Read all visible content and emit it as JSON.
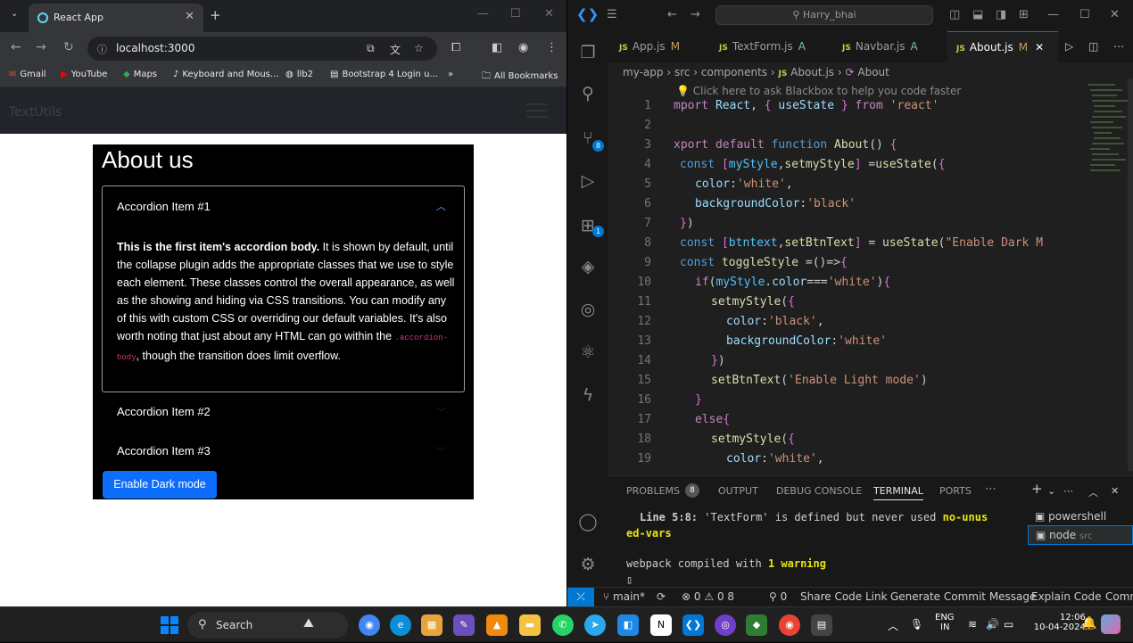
{
  "browser": {
    "tab_title": "React App",
    "url": "localhost:3000",
    "bookmarks": [
      "Gmail",
      "YouTube",
      "Maps",
      "Keyboard and Mous...",
      "llb2",
      "Bootstrap 4 Login u...",
      "All Bookmarks"
    ],
    "page": {
      "brand": "TextUtils",
      "heading": "About us",
      "accordion": [
        {
          "label": "Accordion Item #1",
          "expanded": true,
          "body_strong": "This is the first item's accordion body.",
          "body_text": " It is shown by default, until the collapse plugin adds the appropriate classes that we use to style each element. These classes control the overall appearance, as well as the showing and hiding via CSS transitions. You can modify any of this with custom CSS or overriding our default variables. It's also worth noting that just about any HTML can go within the ",
          "body_code": ".accordion-body",
          "body_tail": ", though the transition does limit overflow."
        },
        {
          "label": "Accordion Item #2",
          "expanded": false
        },
        {
          "label": "Accordion Item #3",
          "expanded": false
        }
      ],
      "button": "Enable Dark mode",
      "accent": "#0d6efd"
    }
  },
  "vscode": {
    "command_center": "Harry_bhai",
    "tabs": [
      {
        "name": "App.js",
        "status": "M"
      },
      {
        "name": "TextForm.js",
        "status": "A"
      },
      {
        "name": "Navbar.js",
        "status": "A"
      },
      {
        "name": "About.js",
        "status": "M"
      }
    ],
    "breadcrumb": [
      "my-app",
      "src",
      "components",
      "About.js",
      "About"
    ],
    "hint": "Click here to ask Blackbox to help you code faster",
    "code_lines": [
      {
        "n": "1",
        "t": "mport React, { useState } from 'react'"
      },
      {
        "n": "2",
        "t": ""
      },
      {
        "n": "3",
        "t": "xport default function About() {"
      },
      {
        "n": "4",
        "t": "const [myStyle,setmyStyle] =useState({"
      },
      {
        "n": "5",
        "t": "color:'white',"
      },
      {
        "n": "6",
        "t": "backgroundColor:'black'"
      },
      {
        "n": "7",
        "t": "})"
      },
      {
        "n": "8",
        "t": "const [btntext,setBtnText] = useState(\"Enable Dark M"
      },
      {
        "n": "9",
        "t": "const toggleStyle =()=>{"
      },
      {
        "n": "10",
        "t": "if(myStyle.color==='white'){"
      },
      {
        "n": "11",
        "t": "setmyStyle({"
      },
      {
        "n": "12",
        "t": "color:'black',"
      },
      {
        "n": "13",
        "t": "backgroundColor:'white'"
      },
      {
        "n": "14",
        "t": "})"
      },
      {
        "n": "15",
        "t": "setBtnText('Enable Light mode')"
      },
      {
        "n": "16",
        "t": "}"
      },
      {
        "n": "17",
        "t": "else{"
      },
      {
        "n": "18",
        "t": "setmyStyle({"
      },
      {
        "n": "19",
        "t": "color:'white',"
      }
    ],
    "panel_tabs": [
      "PROBLEMS",
      "8",
      "OUTPUT",
      "DEBUG CONSOLE",
      "TERMINAL",
      "PORTS"
    ],
    "terminal": {
      "line1_label": "Line 5:8:",
      "line1_msg": "'TextForm' is defined but never used",
      "line1_rule": "no-unus",
      "line2": "ed-vars",
      "compiled_pre": "webpack compiled with ",
      "compiled_warn": "1 warning",
      "shells": [
        "powershell",
        "node",
        "src"
      ]
    },
    "status": {
      "branch": "main*",
      "errors": "0",
      "warnings": "0",
      "info": "8",
      "ports": "0",
      "items": [
        "Share Code Link",
        "Generate Commit Message",
        "Explain Code",
        "Comm"
      ]
    }
  },
  "taskbar": {
    "search": "Search",
    "lang": "ENG",
    "region": "IN",
    "time": "12:06",
    "date": "10-04-2024"
  }
}
